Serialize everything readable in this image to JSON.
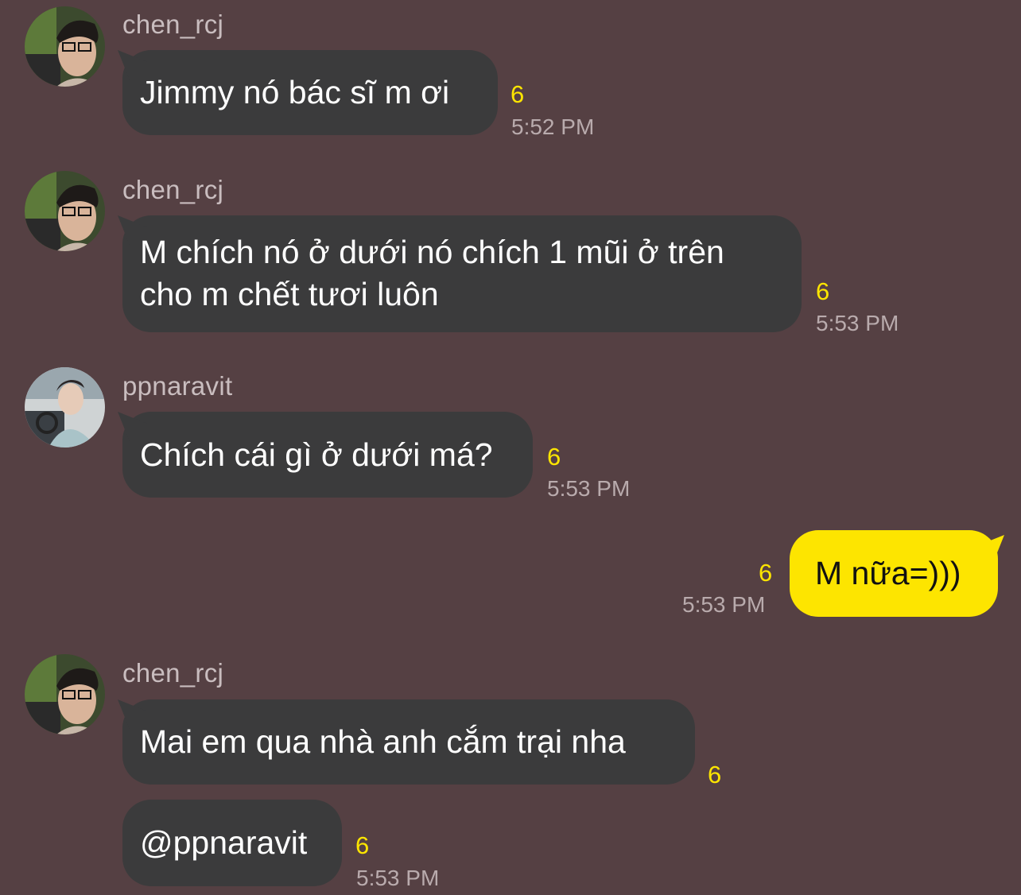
{
  "messages": [
    {
      "sender": "chen_rcj",
      "text": "Jimmy nó bác sĩ m ơi",
      "unread": "6",
      "time": "5:52 PM"
    },
    {
      "sender": "chen_rcj",
      "line1": "M chích nó ở dưới nó chích 1 mũi ở trên",
      "line2": "cho m chết tươi luôn",
      "unread": "6",
      "time": "5:53 PM"
    },
    {
      "sender": "ppnaravit",
      "text": "Chích cái gì ở dưới má?",
      "unread": "6",
      "time": "5:53 PM"
    },
    {
      "sender": "me",
      "text": "M nữa=)))",
      "unread": "6",
      "time": "5:53 PM"
    },
    {
      "sender": "chen_rcj",
      "text": "Mai em qua nhà anh cắm trại nha",
      "unread": "6"
    },
    {
      "sender": "chen_rcj",
      "text": "@ppnaravit",
      "unread": "6",
      "time": "5:53 PM"
    }
  ],
  "colors": {
    "background": "#554043",
    "bubble_other": "#3b3b3c",
    "bubble_mine": "#fde500",
    "unread": "#fde500",
    "timestamp": "#b9abad"
  }
}
